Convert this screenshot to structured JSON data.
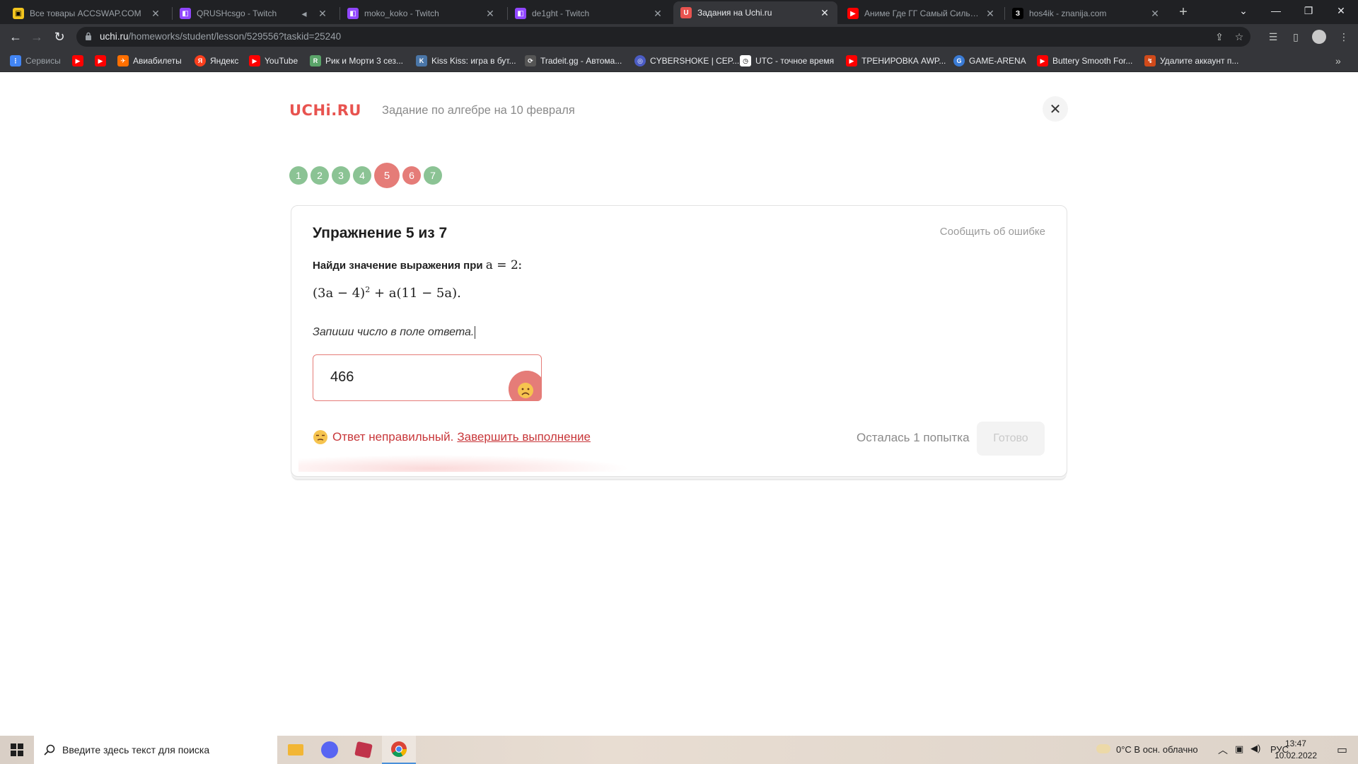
{
  "browser": {
    "tabs": [
      {
        "title": "Все товары ACCSWAP.COM",
        "icon": "accswap-icon",
        "color": "#f2c41e",
        "active": false
      },
      {
        "title": "QRUSHcsgo - Twitch",
        "icon": "twitch-icon",
        "color": "#9147ff",
        "active": false
      },
      {
        "title": "moko_koko - Twitch",
        "icon": "twitch-icon",
        "color": "#9147ff",
        "active": false
      },
      {
        "title": "de1ght - Twitch",
        "icon": "twitch-icon",
        "color": "#9147ff",
        "active": false
      },
      {
        "title": "Задания на Uchi.ru",
        "icon": "uchi-icon",
        "color": "#e8534f",
        "active": true
      },
      {
        "title": "Аниме Где ГГ Самый Сильный",
        "icon": "youtube-icon",
        "color": "#ff0000",
        "active": false
      },
      {
        "title": "hos4ik - znanija.com",
        "icon": "znanija-icon",
        "color": "#000000",
        "active": false
      }
    ],
    "url_host": "uchi.ru",
    "url_path": "/homeworks/student/lesson/529556?taskid=25240",
    "bookmarks": [
      {
        "label": "Сервисы",
        "icon": "apps-icon",
        "color": "#4285f4"
      },
      {
        "label": "",
        "icon": "youtube-icon",
        "color": "#ff0000"
      },
      {
        "label": "",
        "icon": "youtube-icon",
        "color": "#ff0000"
      },
      {
        "label": "Авиабилеты",
        "icon": "aviasales-icon",
        "color": "#ff6f00"
      },
      {
        "label": "Яндекс",
        "icon": "yandex-icon",
        "color": "#fc3f1d"
      },
      {
        "label": "YouTube",
        "icon": "youtube-icon",
        "color": "#ff0000"
      },
      {
        "label": "Рик и Морти 3 сез...",
        "icon": "rick-icon",
        "color": "#5aa469"
      },
      {
        "label": "Kiss Kiss: игра в бут...",
        "icon": "vk-icon",
        "color": "#4a76a8"
      },
      {
        "label": "Tradeit.gg - Автома...",
        "icon": "tradeit-icon",
        "color": "#cccccc"
      },
      {
        "label": "CYBERSHOKE | CEP...",
        "icon": "cybershoke-icon",
        "color": "#4b5cc4"
      },
      {
        "label": "UTC - точное время",
        "icon": "clock-icon",
        "color": "#ffffff"
      },
      {
        "label": "ТРЕНИРОВКА AWP...",
        "icon": "youtube-icon",
        "color": "#ff0000"
      },
      {
        "label": "GAME-ARENA",
        "icon": "gamearena-icon",
        "color": "#3a7bd5"
      },
      {
        "label": "Buttery Smooth For...",
        "icon": "youtube-icon",
        "color": "#ff0000"
      },
      {
        "label": "Удалите аккаунт п...",
        "icon": "bookmark-icon",
        "color": "#d04a1a"
      }
    ]
  },
  "page": {
    "logo": "UCHi.RU",
    "title": "Задание по алгебре на 10 февраля",
    "steps": [
      {
        "label": "1",
        "state": "done"
      },
      {
        "label": "2",
        "state": "done"
      },
      {
        "label": "3",
        "state": "done"
      },
      {
        "label": "4",
        "state": "done"
      },
      {
        "label": "5",
        "state": "current"
      },
      {
        "label": "6",
        "state": "wrong"
      },
      {
        "label": "7",
        "state": "done"
      }
    ],
    "exercise": {
      "title": "Упражнение 5 из 7",
      "report": "Сообщить об ошибке",
      "task_text": "Найди значение выражения при",
      "task_math": "a = 2",
      "task_colon": ":",
      "expr_a": "(3a − 4)",
      "expr_exp": "2",
      "expr_b": " + a(11 − 5a).",
      "hint": "Запиши число в поле ответа.",
      "answer": "466",
      "feedback_text": "Ответ неправильный.",
      "feedback_link": "Завершить выполнение",
      "attempts": "Осталась 1 попытка",
      "done_label": "Готово"
    },
    "colors": {
      "brand": "#e8534f",
      "done": "#8bc394",
      "wrong": "#e57c78",
      "error_text": "#c8373a"
    }
  },
  "taskbar": {
    "search_placeholder": "Введите здесь текст для поиска",
    "apps": [
      "file-explorer-icon",
      "discord-icon",
      "game-icon",
      "chrome-icon"
    ],
    "weather": "0°C  В осн. облачно",
    "lang": "РУС",
    "time": "13:47",
    "date": "10.02.2022"
  }
}
